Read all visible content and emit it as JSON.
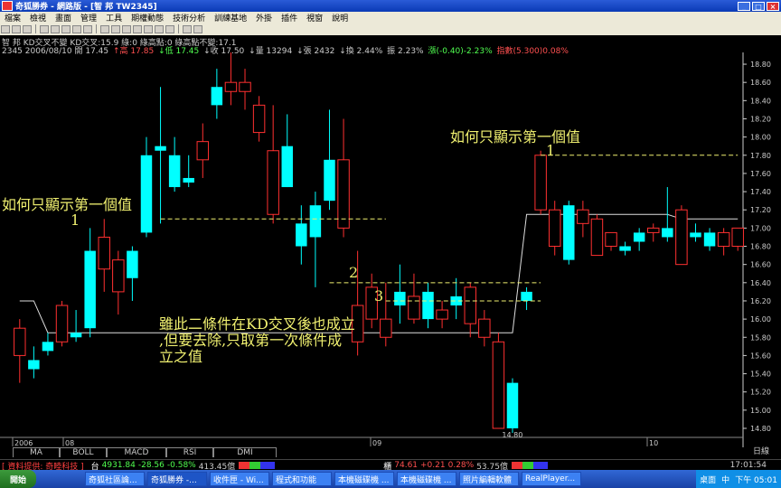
{
  "window": {
    "title": "奇狐勝券 - 網路版 - [智   邦 TW2345]",
    "buttons": [
      "_",
      "□",
      "×"
    ]
  },
  "menu": [
    "檔案",
    "檢視",
    "畫面",
    "管理",
    "工具",
    "期權動態",
    "技術分析",
    "訓練基地",
    "外掛",
    "插件",
    "視窗",
    "說明"
  ],
  "header": {
    "line1": "智   邦 KD交叉不變 KD交叉:15.9 綠:0 綠高點:0 綠高點不變:17.1",
    "line2_parts": [
      {
        "text": "2345 2006/08/10 開 17.45",
        "color": "#cccccc"
      },
      {
        "text": "↑高 17.85",
        "color": "#ff5050"
      },
      {
        "text": "↓低 17.45",
        "color": "#50ff50"
      },
      {
        "text": "↓收 17.50",
        "color": "#cccccc"
      },
      {
        "text": "↓量 13294",
        "color": "#cccccc"
      },
      {
        "text": "↓張 2432",
        "color": "#cccccc"
      },
      {
        "text": "↓換 2.44%",
        "color": "#cccccc"
      },
      {
        "text": "振 2.23%",
        "color": "#cccccc"
      },
      {
        "text": "漲(-0.40)-2.23%",
        "color": "#50ff50"
      },
      {
        "text": "指數(5.300)0.08%",
        "color": "#ff5050"
      }
    ]
  },
  "chart_data": {
    "type": "candlestick",
    "ylim": [
      14.8,
      18.85
    ],
    "yticks": [
      "18.80",
      "18.60",
      "18.40",
      "18.20",
      "18.00",
      "17.80",
      "17.60",
      "17.40",
      "17.20",
      "17.00",
      "16.80",
      "16.60",
      "16.40",
      "16.20",
      "16.00",
      "15.80",
      "15.60",
      "15.40",
      "15.20",
      "15.00",
      "14.80"
    ],
    "high_label": "18.95",
    "low_label": "14.80",
    "xlabels": [
      "2006",
      "08",
      "09",
      "10"
    ],
    "candles": [
      {
        "o": 15.6,
        "c": 15.9,
        "h": 16.0,
        "l": 15.3,
        "up": true
      },
      {
        "o": 15.45,
        "c": 15.55,
        "h": 15.7,
        "l": 15.35,
        "up": false
      },
      {
        "o": 15.65,
        "c": 15.75,
        "h": 15.85,
        "l": 15.6,
        "up": false
      },
      {
        "o": 15.75,
        "c": 16.15,
        "h": 16.2,
        "l": 15.7,
        "up": true
      },
      {
        "o": 15.85,
        "c": 15.8,
        "h": 16.1,
        "l": 15.75,
        "up": false
      },
      {
        "o": 15.9,
        "c": 16.75,
        "h": 17.0,
        "l": 15.8,
        "up": false
      },
      {
        "o": 16.55,
        "c": 16.9,
        "h": 17.1,
        "l": 16.3,
        "up": true
      },
      {
        "o": 16.65,
        "c": 16.3,
        "h": 16.75,
        "l": 16.05,
        "up": true
      },
      {
        "o": 16.45,
        "c": 16.75,
        "h": 16.8,
        "l": 16.2,
        "up": false
      },
      {
        "o": 16.95,
        "c": 17.8,
        "h": 18.0,
        "l": 16.9,
        "up": false
      },
      {
        "o": 17.85,
        "c": 17.9,
        "h": 18.55,
        "l": 17.05,
        "up": false
      },
      {
        "o": 17.45,
        "c": 17.8,
        "h": 18.0,
        "l": 17.4,
        "up": false
      },
      {
        "o": 17.5,
        "c": 17.55,
        "h": 17.8,
        "l": 17.45,
        "up": false
      },
      {
        "o": 17.75,
        "c": 17.95,
        "h": 18.15,
        "l": 17.55,
        "up": true
      },
      {
        "o": 18.35,
        "c": 18.55,
        "h": 18.75,
        "l": 18.2,
        "up": false
      },
      {
        "o": 18.6,
        "c": 18.5,
        "h": 18.95,
        "l": 18.35,
        "up": true
      },
      {
        "o": 18.5,
        "c": 18.6,
        "h": 18.75,
        "l": 18.3,
        "up": true
      },
      {
        "o": 18.35,
        "c": 18.05,
        "h": 18.45,
        "l": 17.95,
        "up": true
      },
      {
        "o": 17.85,
        "c": 17.15,
        "h": 18.35,
        "l": 17.05,
        "up": true
      },
      {
        "o": 17.45,
        "c": 17.9,
        "h": 18.25,
        "l": 17.45,
        "up": false
      },
      {
        "o": 16.8,
        "c": 17.05,
        "h": 17.25,
        "l": 16.6,
        "up": false
      },
      {
        "o": 16.9,
        "c": 17.25,
        "h": 17.4,
        "l": 16.35,
        "up": false
      },
      {
        "o": 17.3,
        "c": 17.75,
        "h": 18.3,
        "l": 17.2,
        "up": false
      },
      {
        "o": 17.75,
        "c": 17.0,
        "h": 18.2,
        "l": 16.9,
        "up": true
      },
      {
        "o": 16.15,
        "c": 15.75,
        "h": 16.75,
        "l": 15.6,
        "up": true
      },
      {
        "o": 16.35,
        "c": 16.0,
        "h": 16.5,
        "l": 15.9,
        "up": true
      },
      {
        "o": 16.0,
        "c": 15.8,
        "h": 16.4,
        "l": 15.7,
        "up": true
      },
      {
        "o": 16.15,
        "c": 16.3,
        "h": 16.6,
        "l": 15.95,
        "up": false
      },
      {
        "o": 16.25,
        "c": 16.0,
        "h": 16.5,
        "l": 15.95,
        "up": true
      },
      {
        "o": 16.3,
        "c": 16.0,
        "h": 16.4,
        "l": 15.9,
        "up": false
      },
      {
        "o": 16.0,
        "c": 16.1,
        "h": 16.2,
        "l": 15.9,
        "up": true
      },
      {
        "o": 16.15,
        "c": 16.25,
        "h": 16.45,
        "l": 16.0,
        "up": false
      },
      {
        "o": 16.35,
        "c": 15.95,
        "h": 16.4,
        "l": 15.8,
        "up": true
      },
      {
        "o": 16.0,
        "c": 15.8,
        "h": 16.1,
        "l": 15.7,
        "up": true
      },
      {
        "o": 15.75,
        "c": 14.8,
        "h": 15.85,
        "l": 14.8,
        "up": true
      },
      {
        "o": 14.8,
        "c": 15.3,
        "h": 15.35,
        "l": 14.75,
        "up": false
      },
      {
        "o": 16.2,
        "c": 16.3,
        "h": 16.35,
        "l": 16.1,
        "up": false
      },
      {
        "o": 17.8,
        "c": 17.2,
        "h": 17.85,
        "l": 17.15,
        "up": true
      },
      {
        "o": 17.2,
        "c": 16.8,
        "h": 17.3,
        "l": 16.7,
        "up": true
      },
      {
        "o": 16.65,
        "c": 17.25,
        "h": 17.3,
        "l": 16.6,
        "up": false
      },
      {
        "o": 17.2,
        "c": 17.05,
        "h": 17.3,
        "l": 16.9,
        "up": true
      },
      {
        "o": 17.1,
        "c": 16.7,
        "h": 17.15,
        "l": 16.7,
        "up": true
      },
      {
        "o": 16.95,
        "c": 16.8,
        "h": 16.95,
        "l": 16.75,
        "up": true
      },
      {
        "o": 16.75,
        "c": 16.8,
        "h": 16.85,
        "l": 16.7,
        "up": false
      },
      {
        "o": 16.85,
        "c": 16.95,
        "h": 17.0,
        "l": 16.75,
        "up": false
      },
      {
        "o": 17.0,
        "c": 16.95,
        "h": 17.05,
        "l": 16.85,
        "up": true
      },
      {
        "o": 16.9,
        "c": 17.0,
        "h": 17.45,
        "l": 16.85,
        "up": false
      },
      {
        "o": 17.2,
        "c": 16.6,
        "h": 17.25,
        "l": 16.6,
        "up": true
      },
      {
        "o": 16.9,
        "c": 16.95,
        "h": 17.05,
        "l": 16.85,
        "up": false
      },
      {
        "o": 16.95,
        "c": 16.8,
        "h": 17.0,
        "l": 16.75,
        "up": false
      },
      {
        "o": 16.8,
        "c": 16.95,
        "h": 17.0,
        "l": 16.7,
        "up": true
      },
      {
        "o": 17.0,
        "c": 16.8,
        "h": 17.0,
        "l": 16.75,
        "up": true
      }
    ],
    "level_line": [
      16.2,
      16.2,
      15.85,
      15.85,
      15.85,
      15.85,
      15.85,
      15.85,
      15.85,
      15.85,
      15.85,
      15.85,
      15.85,
      15.85,
      15.85,
      15.85,
      15.85,
      15.85,
      15.85,
      15.85,
      15.85,
      15.85,
      15.85,
      15.85,
      15.85,
      15.85,
      15.85,
      15.85,
      15.85,
      15.85,
      15.85,
      15.85,
      15.85,
      15.85,
      15.85,
      15.85,
      17.15,
      17.15,
      17.15,
      17.15,
      17.15,
      17.15,
      17.15,
      17.15,
      17.15,
      17.15,
      17.15,
      17.1,
      17.1,
      17.1,
      17.1,
      17.1
    ],
    "dashed_levels": [
      17.1,
      17.8,
      16.4,
      16.2
    ]
  },
  "annotations": {
    "note_left": "如何只顯示第一個值",
    "note_right": "如何只顯示第一個值",
    "num1a": "1",
    "num1b": "1",
    "num2": "2",
    "num3": "3",
    "explain1": "雖此二條件在KD交叉後也成立",
    "explain2": ",但要去除,只取第一次條件成",
    "explain3": "立之值"
  },
  "tabs": [
    "MA",
    "BOLL",
    "MACD",
    "RSI",
    "DMI"
  ],
  "xaxis_right": "日線",
  "status": {
    "source": "[ 資料提供: 奇睦科技 ]",
    "idx1_name": "台",
    "idx1_val": "4931.84",
    "idx1_chg": "-28.56",
    "idx1_pct": "-0.58%",
    "idx1_vol": "413.45億",
    "idx2_name": "櫃",
    "idx2_val": "74.61",
    "idx2_chg": "+0.21",
    "idx2_pct": "0.28%",
    "idx2_vol": "53.75億",
    "clock": "17:01:54"
  },
  "taskbar": {
    "start": "開始",
    "items": [
      "奇狐社區論...",
      "奇狐勝券 -...",
      "收件匣 - Wi...",
      "程式和功能",
      "本機磁碟機 ...",
      "本機磁碟機 ...",
      "照片編輯軟體",
      "RealPlayer..."
    ],
    "tray_label": "桌面",
    "ime": "中",
    "time": "下午 05:01"
  },
  "colors": {
    "up": "#ff3030",
    "down": "#00ffff",
    "annot": "#f0f070",
    "level": "#ffffff"
  }
}
